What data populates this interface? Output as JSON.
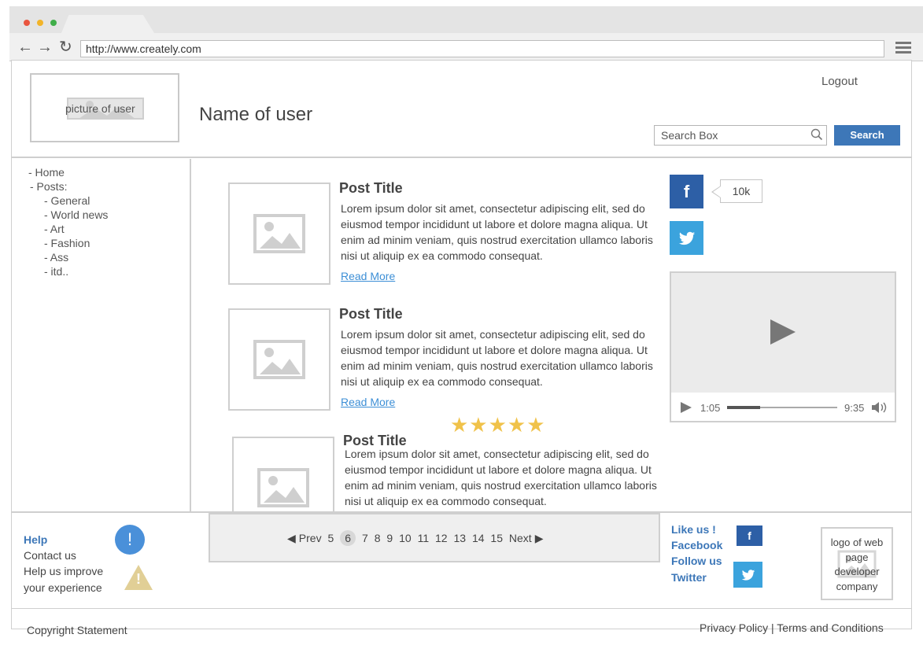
{
  "browser": {
    "url": "http://www.creately.com",
    "window_dots": [
      "#e9553f",
      "#f2b429",
      "#3fae49"
    ]
  },
  "header": {
    "user_picture_label": "picture of user",
    "user_name": "Name of user",
    "logout": "Logout",
    "search_placeholder": "Search Box",
    "search_button": "Search"
  },
  "sidebar": {
    "items": [
      "- Home",
      "- Posts:"
    ],
    "sub_items": [
      "- General",
      "- World news",
      "- Art",
      "- Fashion",
      "- Ass",
      "- itd.."
    ]
  },
  "posts": [
    {
      "title": "Post Title",
      "body": "Lorem ipsum dolor sit amet, consectetur adipiscing elit, sed do eiusmod tempor incididunt ut labore et dolore magna aliqua. Ut enim ad minim veniam, quis nostrud exercitation ullamco laboris nisi ut aliquip ex ea commodo consequat.",
      "read_more": "Read More"
    },
    {
      "title": "Post Title",
      "body": "Lorem ipsum dolor sit amet, consectetur adipiscing elit, sed do eiusmod tempor incididunt ut labore et dolore magna aliqua. Ut enim ad minim veniam, quis nostrud exercitation ullamco laboris nisi ut aliquip ex ea commodo consequat.",
      "read_more": "Read More"
    },
    {
      "title": "Post Title",
      "body": "Lorem ipsum dolor sit amet, consectetur adipiscing elit, sed do eiusmod tempor incididunt ut labore et dolore magna aliqua. Ut enim ad minim veniam, quis nostrud exercitation ullamco laboris nisi ut aliquip ex ea commodo consequat."
    }
  ],
  "rating": {
    "stars": "★★★★★",
    "value": 5,
    "max": 5
  },
  "social": {
    "facebook_glyph": "f",
    "like_count": "10k"
  },
  "video": {
    "current_time": "1:05",
    "total_time": "9:35",
    "progress_fraction": 0.3
  },
  "footer": {
    "help": "Help",
    "contact": "Contact us",
    "improve_line1": "Help us improve",
    "improve_line2": "your experience",
    "info_glyph": "!",
    "warning_glyph": "!",
    "pager": {
      "prev": "Prev",
      "next": "Next",
      "pages": [
        "5",
        "6",
        "7",
        "8",
        "9",
        "10",
        "11",
        "12",
        "13",
        "14",
        "15"
      ],
      "current": "6"
    },
    "like_us": "Like us !",
    "facebook": "Facebook",
    "follow_us": "Follow us",
    "twitter": "Twitter",
    "facebook_glyph": "f",
    "dev_logo_text": "logo of web page developer company",
    "copyright": "Copyright Statement",
    "privacy_terms": "Privacy Policy | Terms and Conditions"
  }
}
